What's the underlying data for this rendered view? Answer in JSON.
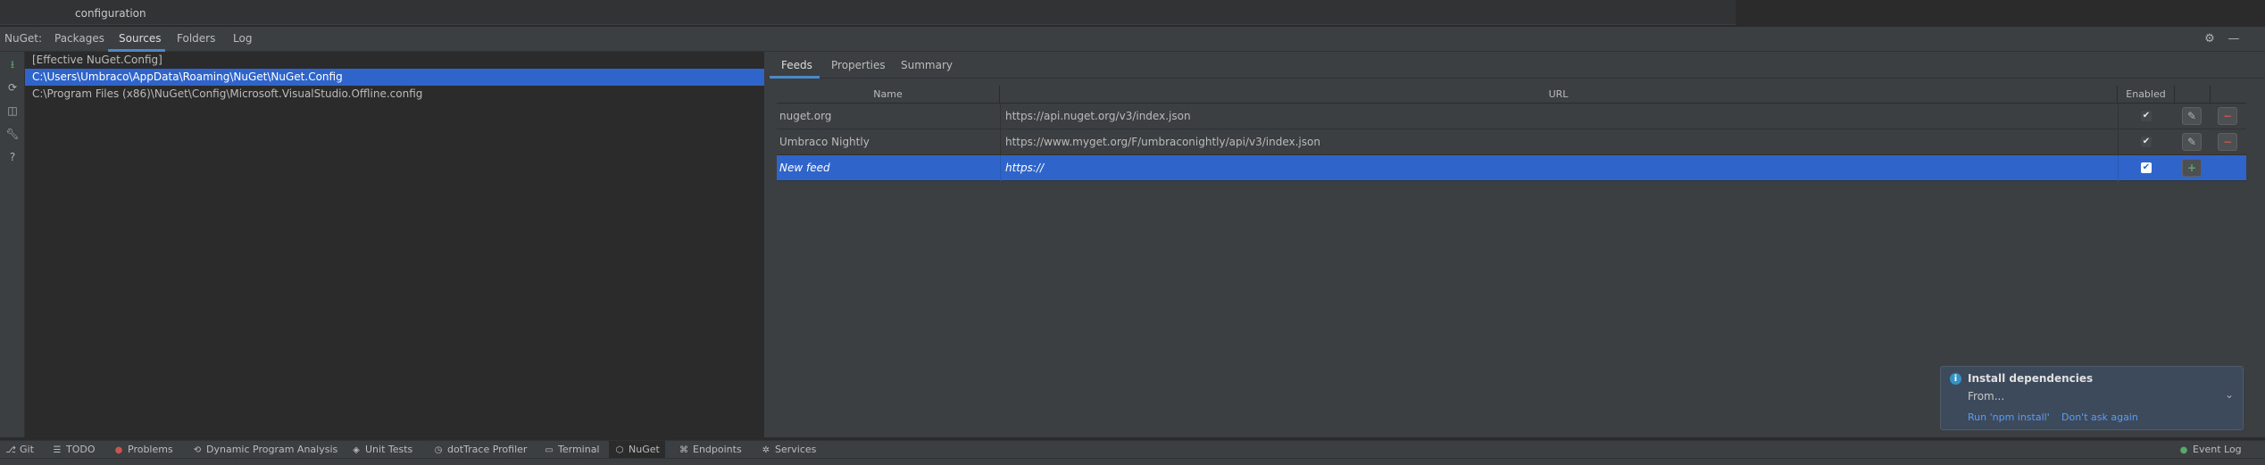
{
  "window": {
    "tab_title": "configuration"
  },
  "nuget": {
    "label": "NuGet:",
    "tabs": [
      {
        "label": "Packages"
      },
      {
        "label": "Sources"
      },
      {
        "label": "Folders"
      },
      {
        "label": "Log"
      }
    ],
    "active_tab": "Sources"
  },
  "sources": {
    "items": [
      {
        "label": "[Effective NuGet.Config]"
      },
      {
        "label": "C:\\Users\\Umbraco\\AppData\\Roaming\\NuGet\\NuGet.Config"
      },
      {
        "label": "C:\\Program Files (x86)\\NuGet\\Config\\Microsoft.VisualStudio.Offline.config"
      }
    ],
    "selected_index": 1
  },
  "details": {
    "tabs": [
      {
        "label": "Feeds"
      },
      {
        "label": "Properties"
      },
      {
        "label": "Summary"
      }
    ],
    "active_tab": "Feeds"
  },
  "feeds_table": {
    "columns": {
      "name": "Name",
      "url": "URL",
      "enabled": "Enabled"
    },
    "rows": [
      {
        "name": "nuget.org",
        "url": "https://api.nuget.org/v3/index.json",
        "enabled": true
      },
      {
        "name": "Umbraco Nightly",
        "url": "https://www.myget.org/F/umbraconightly/api/v3/index.json",
        "enabled": true
      }
    ],
    "new_row": {
      "name": "New feed",
      "url": "https://",
      "enabled": true
    }
  },
  "notification": {
    "title": "Install dependencies",
    "body": "From...",
    "actions": [
      {
        "label": "Run 'npm install'"
      },
      {
        "label": "Don't ask again"
      }
    ]
  },
  "bottom_bar": {
    "items": [
      {
        "label": "Git",
        "icon": "git-branch-icon"
      },
      {
        "label": "TODO",
        "icon": "list-icon"
      },
      {
        "label": "Problems",
        "icon": "error-icon"
      },
      {
        "label": "Dynamic Program Analysis",
        "icon": "analysis-icon"
      },
      {
        "label": "Unit Tests",
        "icon": "unit-tests-icon"
      },
      {
        "label": "dotTrace Profiler",
        "icon": "profiler-icon"
      },
      {
        "label": "Terminal",
        "icon": "terminal-icon"
      },
      {
        "label": "NuGet",
        "icon": "nuget-icon"
      },
      {
        "label": "Endpoints",
        "icon": "endpoints-icon"
      },
      {
        "label": "Services",
        "icon": "services-icon"
      }
    ],
    "active": "NuGet",
    "event_log": "Event Log"
  }
}
